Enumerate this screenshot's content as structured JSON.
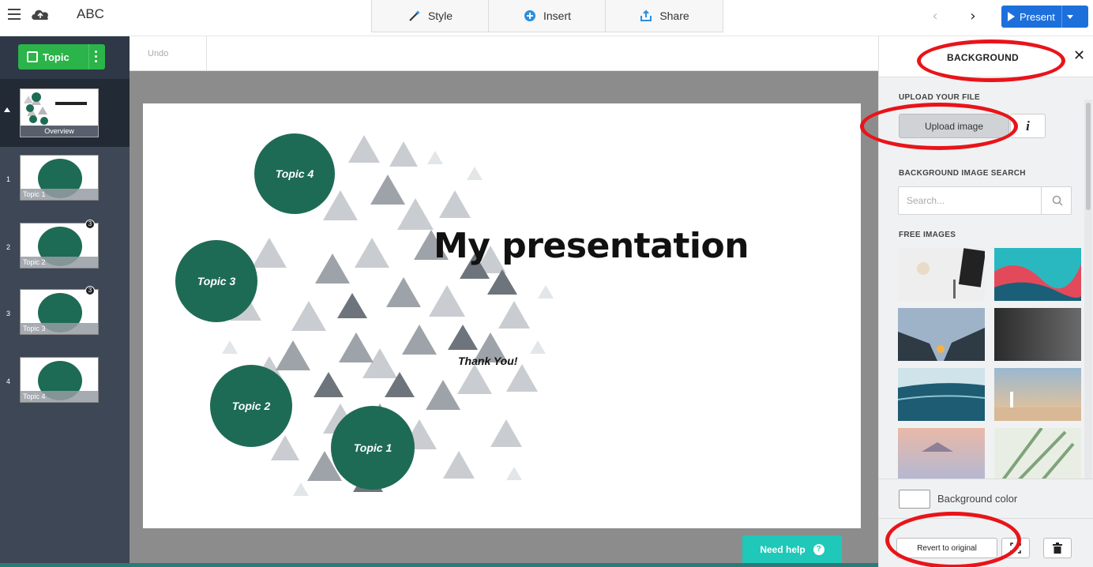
{
  "topbar": {
    "app_title": "ABC",
    "tabs": [
      {
        "label": "Style",
        "icon": "magic-wand-icon"
      },
      {
        "label": "Insert",
        "icon": "plus-circle-icon"
      },
      {
        "label": "Share",
        "icon": "share-icon"
      }
    ],
    "present_label": "Present",
    "accent_color": "#1d6fdc"
  },
  "sidebar": {
    "topic_button_label": "Topic",
    "overview_label": "Overview",
    "slides": [
      {
        "number": "1",
        "label": "Topic 1",
        "badge": ""
      },
      {
        "number": "2",
        "label": "Topic 2",
        "badge": "3"
      },
      {
        "number": "3",
        "label": "Topic 3",
        "badge": "3"
      },
      {
        "number": "4",
        "label": "Topic 4",
        "badge": ""
      }
    ],
    "accent_color": "#2ab449"
  },
  "canvas": {
    "undo_label": "Undo",
    "slide_title": "My presentation",
    "closing_text": "Thank You!",
    "topics": [
      "Topic 1",
      "Topic 2",
      "Topic 3",
      "Topic 4"
    ],
    "topic_color": "#1e6b55",
    "help_label": "Need help"
  },
  "panel": {
    "title": "BACKGROUND",
    "upload_section": "UPLOAD YOUR FILE",
    "upload_button": "Upload image",
    "info_button": "i",
    "search_section": "BACKGROUND IMAGE SEARCH",
    "search_placeholder": "Search...",
    "free_images_section": "FREE IMAGES",
    "background_color_label": "Background color",
    "revert_label": "Revert to original",
    "annotation_color": "#e8141a"
  }
}
